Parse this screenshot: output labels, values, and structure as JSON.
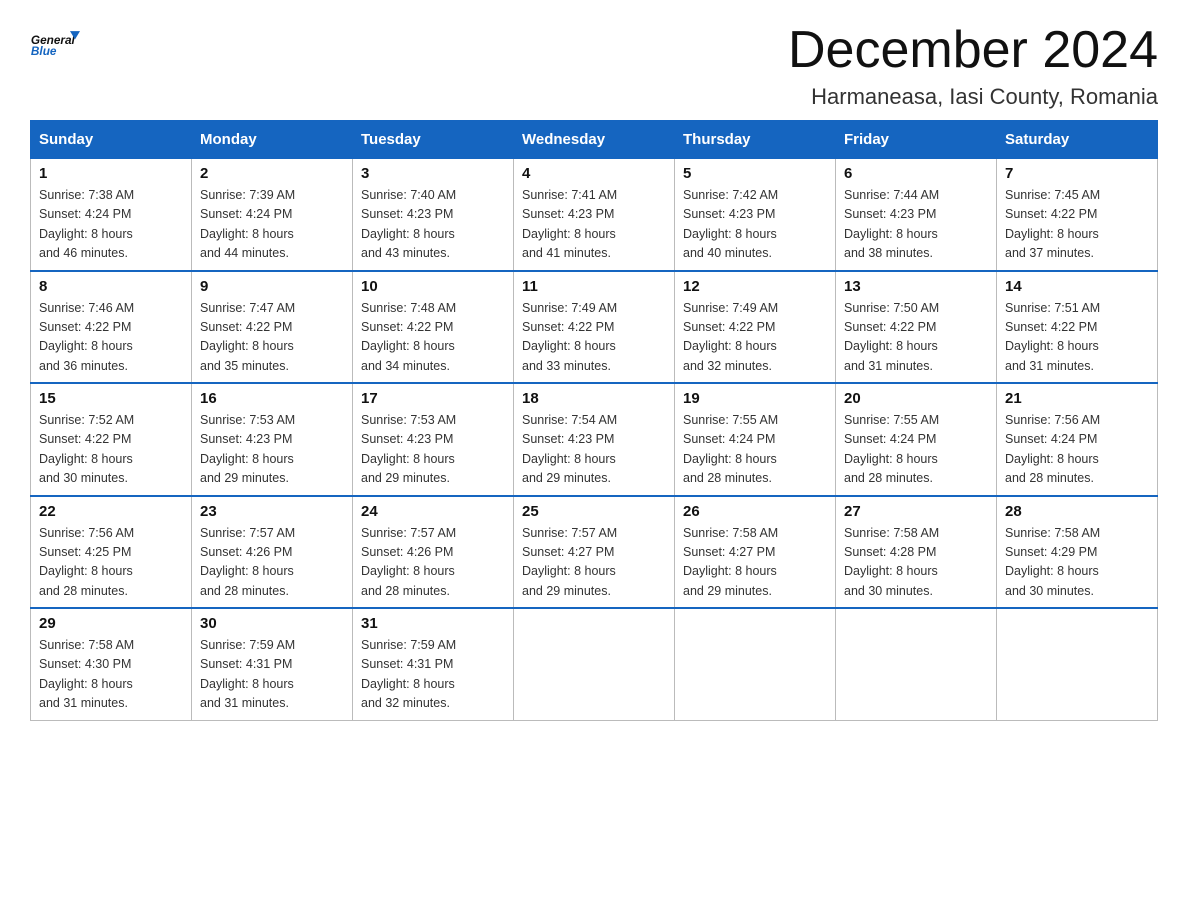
{
  "header": {
    "logo_general": "General",
    "logo_blue": "Blue",
    "month_title": "December 2024",
    "location": "Harmaneasa, Iasi County, Romania"
  },
  "days_of_week": [
    "Sunday",
    "Monday",
    "Tuesday",
    "Wednesday",
    "Thursday",
    "Friday",
    "Saturday"
  ],
  "weeks": [
    [
      {
        "day": "1",
        "sunrise": "7:38 AM",
        "sunset": "4:24 PM",
        "daylight": "8 hours and 46 minutes."
      },
      {
        "day": "2",
        "sunrise": "7:39 AM",
        "sunset": "4:24 PM",
        "daylight": "8 hours and 44 minutes."
      },
      {
        "day": "3",
        "sunrise": "7:40 AM",
        "sunset": "4:23 PM",
        "daylight": "8 hours and 43 minutes."
      },
      {
        "day": "4",
        "sunrise": "7:41 AM",
        "sunset": "4:23 PM",
        "daylight": "8 hours and 41 minutes."
      },
      {
        "day": "5",
        "sunrise": "7:42 AM",
        "sunset": "4:23 PM",
        "daylight": "8 hours and 40 minutes."
      },
      {
        "day": "6",
        "sunrise": "7:44 AM",
        "sunset": "4:23 PM",
        "daylight": "8 hours and 38 minutes."
      },
      {
        "day": "7",
        "sunrise": "7:45 AM",
        "sunset": "4:22 PM",
        "daylight": "8 hours and 37 minutes."
      }
    ],
    [
      {
        "day": "8",
        "sunrise": "7:46 AM",
        "sunset": "4:22 PM",
        "daylight": "8 hours and 36 minutes."
      },
      {
        "day": "9",
        "sunrise": "7:47 AM",
        "sunset": "4:22 PM",
        "daylight": "8 hours and 35 minutes."
      },
      {
        "day": "10",
        "sunrise": "7:48 AM",
        "sunset": "4:22 PM",
        "daylight": "8 hours and 34 minutes."
      },
      {
        "day": "11",
        "sunrise": "7:49 AM",
        "sunset": "4:22 PM",
        "daylight": "8 hours and 33 minutes."
      },
      {
        "day": "12",
        "sunrise": "7:49 AM",
        "sunset": "4:22 PM",
        "daylight": "8 hours and 32 minutes."
      },
      {
        "day": "13",
        "sunrise": "7:50 AM",
        "sunset": "4:22 PM",
        "daylight": "8 hours and 31 minutes."
      },
      {
        "day": "14",
        "sunrise": "7:51 AM",
        "sunset": "4:22 PM",
        "daylight": "8 hours and 31 minutes."
      }
    ],
    [
      {
        "day": "15",
        "sunrise": "7:52 AM",
        "sunset": "4:22 PM",
        "daylight": "8 hours and 30 minutes."
      },
      {
        "day": "16",
        "sunrise": "7:53 AM",
        "sunset": "4:23 PM",
        "daylight": "8 hours and 29 minutes."
      },
      {
        "day": "17",
        "sunrise": "7:53 AM",
        "sunset": "4:23 PM",
        "daylight": "8 hours and 29 minutes."
      },
      {
        "day": "18",
        "sunrise": "7:54 AM",
        "sunset": "4:23 PM",
        "daylight": "8 hours and 29 minutes."
      },
      {
        "day": "19",
        "sunrise": "7:55 AM",
        "sunset": "4:24 PM",
        "daylight": "8 hours and 28 minutes."
      },
      {
        "day": "20",
        "sunrise": "7:55 AM",
        "sunset": "4:24 PM",
        "daylight": "8 hours and 28 minutes."
      },
      {
        "day": "21",
        "sunrise": "7:56 AM",
        "sunset": "4:24 PM",
        "daylight": "8 hours and 28 minutes."
      }
    ],
    [
      {
        "day": "22",
        "sunrise": "7:56 AM",
        "sunset": "4:25 PM",
        "daylight": "8 hours and 28 minutes."
      },
      {
        "day": "23",
        "sunrise": "7:57 AM",
        "sunset": "4:26 PM",
        "daylight": "8 hours and 28 minutes."
      },
      {
        "day": "24",
        "sunrise": "7:57 AM",
        "sunset": "4:26 PM",
        "daylight": "8 hours and 28 minutes."
      },
      {
        "day": "25",
        "sunrise": "7:57 AM",
        "sunset": "4:27 PM",
        "daylight": "8 hours and 29 minutes."
      },
      {
        "day": "26",
        "sunrise": "7:58 AM",
        "sunset": "4:27 PM",
        "daylight": "8 hours and 29 minutes."
      },
      {
        "day": "27",
        "sunrise": "7:58 AM",
        "sunset": "4:28 PM",
        "daylight": "8 hours and 30 minutes."
      },
      {
        "day": "28",
        "sunrise": "7:58 AM",
        "sunset": "4:29 PM",
        "daylight": "8 hours and 30 minutes."
      }
    ],
    [
      {
        "day": "29",
        "sunrise": "7:58 AM",
        "sunset": "4:30 PM",
        "daylight": "8 hours and 31 minutes."
      },
      {
        "day": "30",
        "sunrise": "7:59 AM",
        "sunset": "4:31 PM",
        "daylight": "8 hours and 31 minutes."
      },
      {
        "day": "31",
        "sunrise": "7:59 AM",
        "sunset": "4:31 PM",
        "daylight": "8 hours and 32 minutes."
      },
      null,
      null,
      null,
      null
    ]
  ],
  "labels": {
    "sunrise_prefix": "Sunrise: ",
    "sunset_prefix": "Sunset: ",
    "daylight_prefix": "Daylight: "
  }
}
